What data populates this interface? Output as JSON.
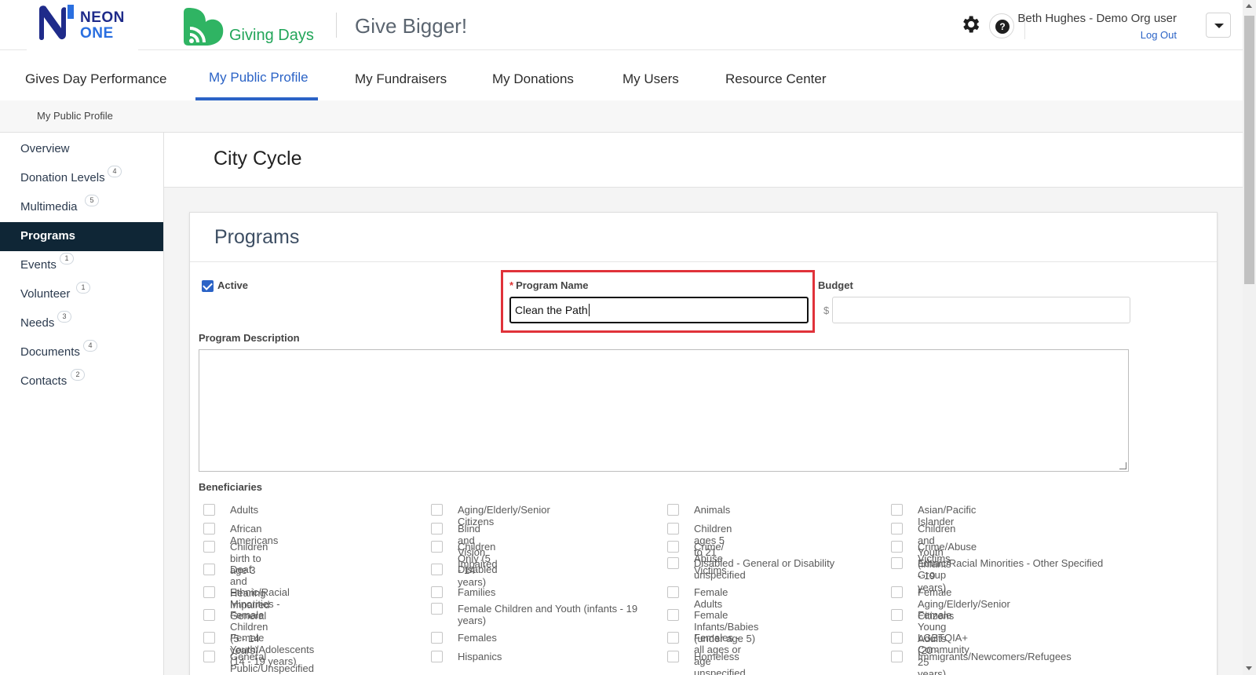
{
  "header": {
    "neon_line1": "NEON",
    "neon_line2": "ONE",
    "giving_days": "Giving Days",
    "tagline": "Give Bigger!",
    "user_name": "Beth Hughes - Demo Org user",
    "logout": "Log Out",
    "icons": [
      "gear-icon",
      "help-icon",
      "chevron-down-icon"
    ]
  },
  "nav": {
    "items": [
      {
        "label": "Gives Day Performance"
      },
      {
        "label": "My Public Profile",
        "active": true
      },
      {
        "label": "My Fundraisers"
      },
      {
        "label": "My Donations"
      },
      {
        "label": "My Users"
      },
      {
        "label": "Resource Center"
      }
    ]
  },
  "breadcrumb": "My Public Profile",
  "sidebar": {
    "items": [
      {
        "label": "Overview",
        "badge": ""
      },
      {
        "label": "Donation Levels",
        "badge": "4"
      },
      {
        "label": "Multimedia",
        "badge": "5"
      },
      {
        "label": "Programs",
        "badge": "",
        "active": true
      },
      {
        "label": "Events",
        "badge": "1"
      },
      {
        "label": "Volunteer",
        "badge": "1"
      },
      {
        "label": "Needs",
        "badge": "3"
      },
      {
        "label": "Documents",
        "badge": "4"
      },
      {
        "label": "Contacts",
        "badge": "2"
      }
    ]
  },
  "page_title": "City Cycle",
  "programs": {
    "title": "Programs",
    "active_label": "Active",
    "active_checked": true,
    "program_name_required": "*",
    "program_name_label": "Program Name",
    "program_name_value": "Clean the Path",
    "budget_label": "Budget",
    "budget_currency": "$",
    "budget_value": "",
    "description_label": "Program Description",
    "description_value": "",
    "beneficiaries_label": "Beneficiaries",
    "beneficiaries": [
      [
        "Adults",
        "Aging/Elderly/Senior Citizens",
        "Animals",
        "Asian/Pacific Islander"
      ],
      [
        "African Americans",
        "Blind and Vision Impaired",
        "Children ages 5 to 21",
        "Children and Youth (infants - 19 years)"
      ],
      [
        "Children birth to age 3",
        "Children Only (5 - 14 years)",
        "Crime/ Abuse Victims",
        "Crime/Abuse Victims"
      ],
      [
        "Deaf and Hearing Impaired",
        "Disabled",
        "Disabled - General or Disability unspecified",
        "Ethnic/Racial Minorities - Other Specified Group"
      ],
      [
        "Ethnic/Racial Minorities - General",
        "Families",
        "Female Adults",
        "Female Aging/Elderly/Senior Citizens"
      ],
      [
        "Female Children (5 - 14 years)",
        "Female Children and Youth (infants - 19 years)",
        "Female Infants/Babies (under age 5)",
        "Female Young Adults (20 - 25 years)"
      ],
      [
        "Female Youth/Adolescents (14 - 19 years)",
        "Females",
        "Females - all ages or age unspecified",
        "LGBTQIA+ Community"
      ],
      [
        "General Public/Unspecified",
        "Hispanics",
        "Homeless",
        "Immigrants/Newcomers/Refugees"
      ]
    ]
  }
}
